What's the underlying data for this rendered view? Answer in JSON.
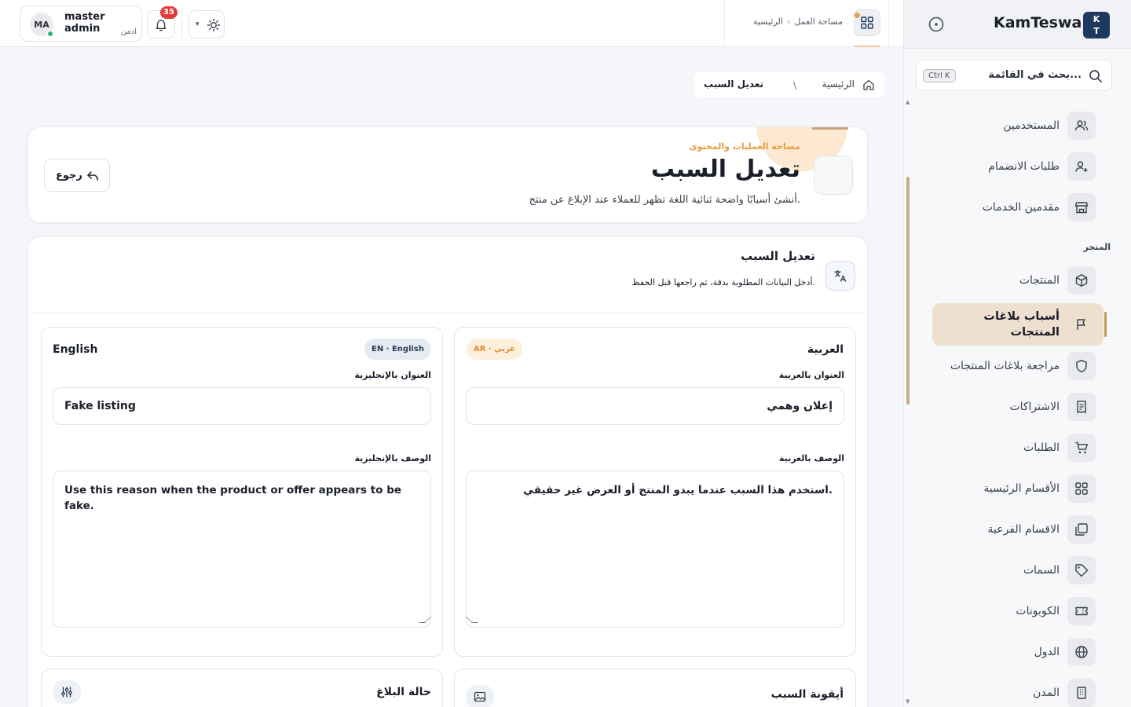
{
  "sidebar": {
    "logo_initials_top": "K",
    "logo_initials_bottom": "T",
    "brand": "KamTeswa",
    "search_placeholder": "بحث في القائمة...",
    "search_shortcut": "Ctrl K",
    "section_store": "المتجر",
    "items": [
      {
        "label": "المستخدمين",
        "icon": "users-icon"
      },
      {
        "label": "طلبات الانضمام",
        "icon": "user-plus-icon"
      },
      {
        "label": "مقدمين الخدمات",
        "icon": "store-icon"
      },
      {
        "label": "المنتجات",
        "icon": "box-icon"
      },
      {
        "label": "أسباب بلاغات المنتجات",
        "icon": "flag-icon",
        "active": true
      },
      {
        "label": "مراجعة بلاغات المنتجات",
        "icon": "shield-icon"
      },
      {
        "label": "الاشتراكات",
        "icon": "receipt-icon"
      },
      {
        "label": "الطلبات",
        "icon": "cart-icon"
      },
      {
        "label": "الأقسام الرئيسية",
        "icon": "grid-icon"
      },
      {
        "label": "الاقسام الفرعية",
        "icon": "layers-icon"
      },
      {
        "label": "السمات",
        "icon": "tag-icon"
      },
      {
        "label": "الكوبونات",
        "icon": "ticket-icon"
      },
      {
        "label": "الدول",
        "icon": "globe-icon"
      },
      {
        "label": "المدن",
        "icon": "building-icon"
      }
    ]
  },
  "topbar": {
    "workspace_crumb_home": "الرئيسية",
    "workspace_crumb_current": "مساحة العمل",
    "user_initials": "MA",
    "user_name": "master admin",
    "user_role": "ادمن",
    "notifications_count": "35"
  },
  "page_breadcrumb": {
    "home": "الرئيسية",
    "separator": "\\",
    "current": "تعديل السبب"
  },
  "hero": {
    "kicker": "مساحة العمليات والمحتوى",
    "title": "تعديل السبب",
    "subtitle": "أنشئ أسبابًا واضحة ثنائية اللغة تظهر للعملاء عند الإبلاغ عن منتج.",
    "back_label": "رجوع"
  },
  "form": {
    "title": "تعديل السبب",
    "subtitle": "أدخل البيانات المطلوبة بدقة، ثم راجعها قبل الحفظ.",
    "arabic": {
      "panel_title": "العربية",
      "chip": "AR · عربي",
      "title_label": "العنوان بالعربية",
      "title_value": "إعلان وهمي",
      "desc_label": "الوصف بالعربية",
      "desc_value": "استخدم هذا السبب عندما يبدو المنتج أو العرض غير حقيقي."
    },
    "english": {
      "panel_title": "English",
      "chip": "EN · English",
      "title_label": "العنوان بالإنجليزية",
      "title_value": "Fake listing",
      "desc_label": "الوصف بالإنجليزية",
      "desc_value": "Use this reason when the product or offer appears to be fake."
    },
    "icon_section_title": "أيقونة السبب",
    "status_section_title": "حالة البلاغ"
  },
  "colors": {
    "accent": "#e69a3c",
    "sidebar_active_bg": "#eedfcf",
    "brand_dark": "#1f3a5f",
    "notification_badge": "#e23b3b",
    "online": "#2bb673"
  }
}
